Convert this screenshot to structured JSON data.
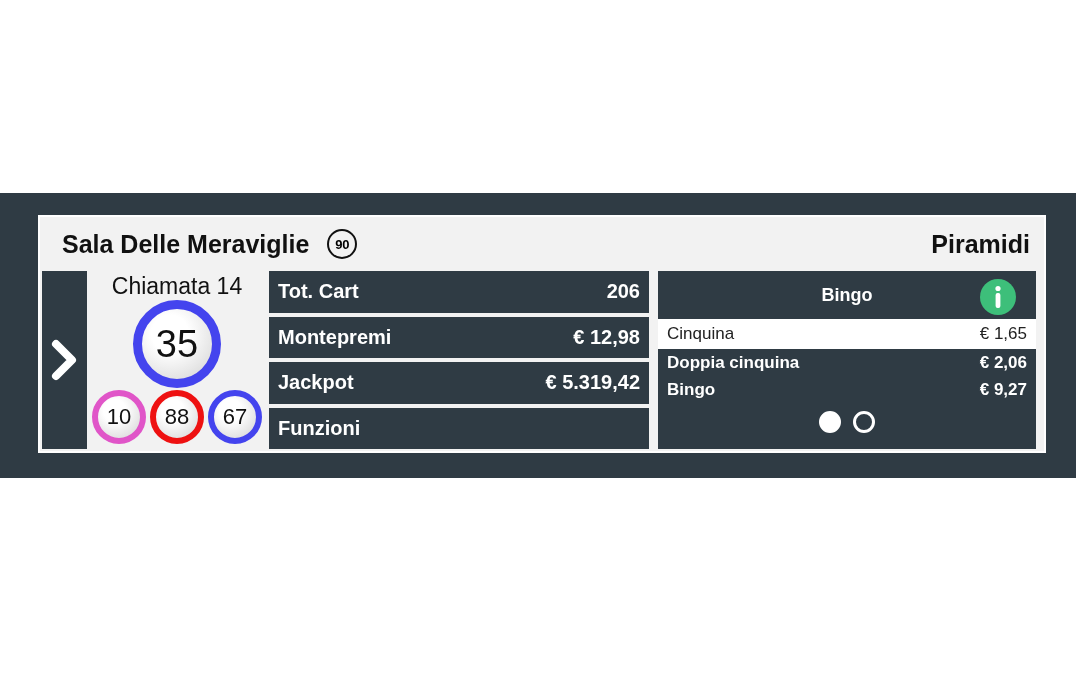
{
  "room": {
    "name": "Sala Delle Meraviglie",
    "ball_type": "90",
    "game": "Piramidi"
  },
  "call": {
    "label": "Chiamata 14",
    "current": {
      "number": "35",
      "color": "#4444ee"
    },
    "previous": [
      {
        "number": "10",
        "color": "#e055c8"
      },
      {
        "number": "88",
        "color": "#ee1111"
      },
      {
        "number": "67",
        "color": "#4444ee"
      }
    ]
  },
  "stats": [
    {
      "label": "Tot. Cart",
      "value": "206"
    },
    {
      "label": "Montepremi",
      "value": "€ 12,98"
    },
    {
      "label": "Jackpot",
      "value": "€ 5.319,42"
    },
    {
      "label": "Funzioni"
    }
  ],
  "prizes": {
    "title": "Bingo",
    "rows": [
      {
        "label": "Cinquina",
        "value": "€ 1,65",
        "selected": true
      },
      {
        "label": "Doppia cinquina",
        "value": "€ 2,06",
        "selected": false
      },
      {
        "label": "Bingo",
        "value": "€ 9,27",
        "selected": false
      }
    ],
    "pages": [
      {
        "selected": true
      },
      {
        "selected": false
      }
    ]
  }
}
